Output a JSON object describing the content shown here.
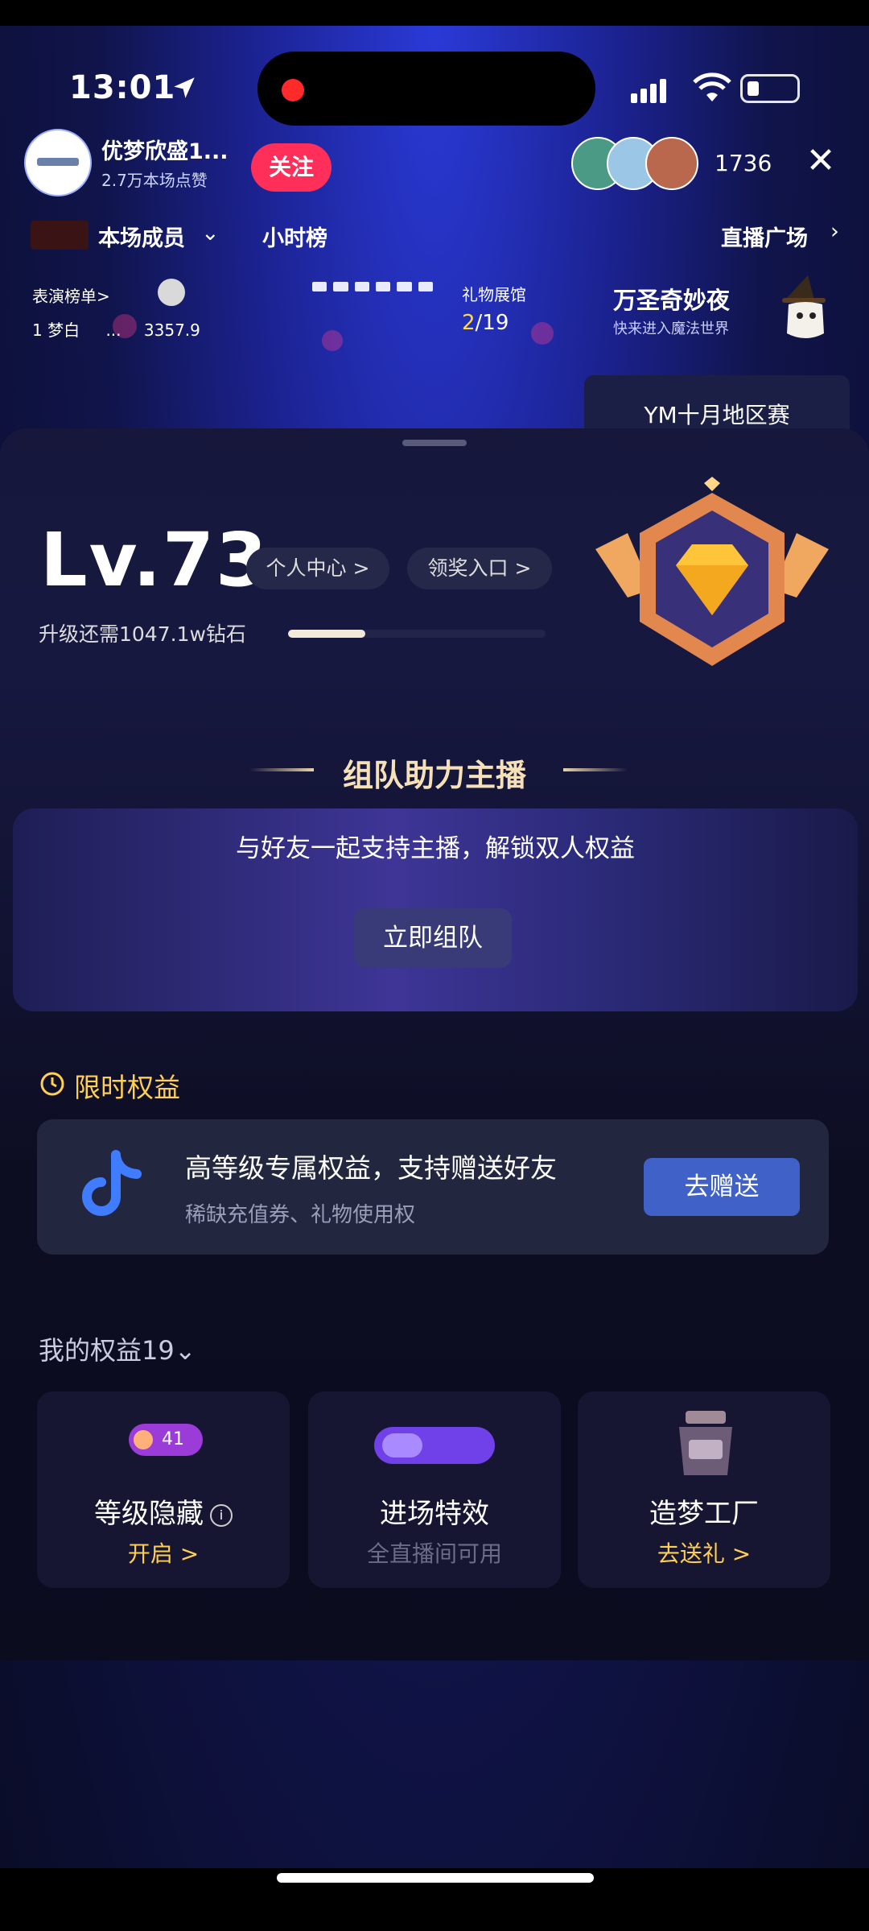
{
  "status_bar": {
    "time": "13:01"
  },
  "anchor": {
    "name": "优梦欣盛1...",
    "likes": "2.7万本场点赞",
    "follow_label": "关注",
    "viewer_count": "1736",
    "close_label": "✕"
  },
  "nav": {
    "members_label": "本场成员",
    "hour_rank_label": "小时榜",
    "live_square_label": "直播广场",
    "chevron_right": "›",
    "chevron_down": "⌄"
  },
  "ticker": {
    "perf_rank_label": "表演榜单",
    "perf_rank_arrow": ">",
    "rank_entry": {
      "rank": "1",
      "name": "梦白",
      "ellipsis": "...",
      "score": "3357.9"
    },
    "gift_hall_label": "礼物展馆",
    "gift_progress_current": "2",
    "gift_progress_total": "/19",
    "event_title": "万圣奇妙夜",
    "event_subtitle": "快来进入魔法世界"
  },
  "region_tab": "YM十月地区赛",
  "level_panel": {
    "level": "Lv.73",
    "personal_center": "个人中心 >",
    "claim_entry": "领奖入口 >",
    "upgrade_need": "升级还需1047.1w钻石",
    "upgrade_progress": 0.3
  },
  "team": {
    "title": "组队助力主播",
    "description": "与好友一起支持主播，解锁双人权益",
    "button": "立即组队"
  },
  "limited": {
    "title": "限时权益",
    "card_title": "高等级专属权益，支持赠送好友",
    "card_subtitle": "稀缺充值券、礼物使用权",
    "card_button": "去赠送"
  },
  "my_benefits": {
    "title": "我的权益19",
    "chevron": "⌄",
    "cards": [
      {
        "badge": "41",
        "label": "等级隐藏",
        "info": "i",
        "sub": "开启 >"
      },
      {
        "label": "进场特效",
        "sub": "全直播间可用"
      },
      {
        "label": "造梦工厂",
        "sub": "去送礼 >"
      }
    ]
  },
  "colors": {
    "accent_gold": "#ffcf52",
    "follow_red": "#ff2f5a",
    "button_blue": "#3f61c8",
    "badge_purple": "#9b3bd8"
  }
}
